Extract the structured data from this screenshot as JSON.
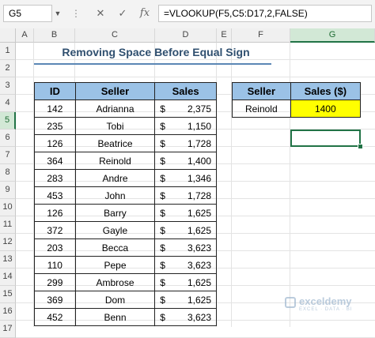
{
  "formula_bar": {
    "name_box": "G5",
    "formula": "=VLOOKUP(F5,C5:D17,2,FALSE)"
  },
  "columns": [
    "A",
    "B",
    "C",
    "D",
    "E",
    "F",
    "G"
  ],
  "selected_column": "G",
  "rows": [
    "1",
    "2",
    "3",
    "4",
    "5",
    "6",
    "7",
    "8",
    "9",
    "10",
    "11",
    "12",
    "13",
    "14",
    "15",
    "16",
    "17"
  ],
  "selected_row": "5",
  "title": "Removing Space Before Equal Sign",
  "main_table": {
    "headers": [
      "ID",
      "Seller",
      "Sales"
    ],
    "currency": "$",
    "rows": [
      {
        "id": "142",
        "seller": "Adrianna",
        "sales": "2,375"
      },
      {
        "id": "235",
        "seller": "Tobi",
        "sales": "1,150"
      },
      {
        "id": "126",
        "seller": "Beatrice",
        "sales": "1,728"
      },
      {
        "id": "364",
        "seller": "Reinold",
        "sales": "1,400"
      },
      {
        "id": "283",
        "seller": "Andre",
        "sales": "1,346"
      },
      {
        "id": "453",
        "seller": "John",
        "sales": "1,728"
      },
      {
        "id": "126",
        "seller": "Barry",
        "sales": "1,625"
      },
      {
        "id": "372",
        "seller": "Gayle",
        "sales": "1,625"
      },
      {
        "id": "203",
        "seller": "Becca",
        "sales": "3,623"
      },
      {
        "id": "110",
        "seller": "Pepe",
        "sales": "3,623"
      },
      {
        "id": "299",
        "seller": "Ambrose",
        "sales": "1,625"
      },
      {
        "id": "369",
        "seller": "Dom",
        "sales": "1,625"
      },
      {
        "id": "452",
        "seller": "Benn",
        "sales": "3,623"
      }
    ]
  },
  "lookup_table": {
    "headers": [
      "Seller",
      "Sales ($)"
    ],
    "seller": "Reinold",
    "result": "1400"
  },
  "watermark": {
    "name": "exceldemy",
    "tagline": "EXCEL · DATA · BI"
  },
  "colors": {
    "header_fill": "#9bc2e6",
    "result_fill": "#ffff00",
    "selection": "#217346"
  }
}
